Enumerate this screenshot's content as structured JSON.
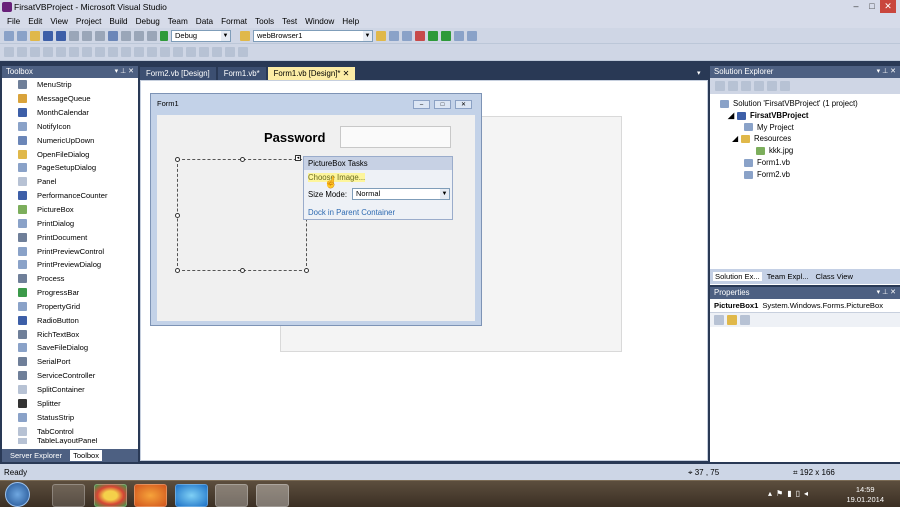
{
  "window": {
    "title": "FirsatVBProject - Microsoft Visual Studio"
  },
  "menu": [
    "File",
    "Edit",
    "View",
    "Project",
    "Build",
    "Debug",
    "Team",
    "Data",
    "Format",
    "Tools",
    "Test",
    "Window",
    "Help"
  ],
  "toolbar": {
    "config": "Debug",
    "target": "webBrowser1"
  },
  "toolbox": {
    "title": "Toolbox",
    "items": [
      "MenuStrip",
      "MessageQueue",
      "MonthCalendar",
      "NotifyIcon",
      "NumericUpDown",
      "OpenFileDialog",
      "PageSetupDialog",
      "Panel",
      "PerformanceCounter",
      "PictureBox",
      "PrintDialog",
      "PrintDocument",
      "PrintPreviewControl",
      "PrintPreviewDialog",
      "Process",
      "ProgressBar",
      "PropertyGrid",
      "RadioButton",
      "RichTextBox",
      "SaveFileDialog",
      "SerialPort",
      "ServiceController",
      "SplitContainer",
      "Splitter",
      "StatusStrip",
      "TabControl",
      "TableLayoutPanel"
    ],
    "bottom_tabs": [
      "Server Explorer",
      "Toolbox"
    ]
  },
  "doc_tabs": [
    "Form2.vb [Design]",
    "Form1.vb*",
    "Form1.vb [Design]*"
  ],
  "form": {
    "caption": "Form1",
    "password_label": "Password"
  },
  "tasks": {
    "title": "PictureBox Tasks",
    "choose": "Choose Image...",
    "size_mode_label": "Size Mode:",
    "size_mode_value": "Normal",
    "dock": "Dock in Parent Container"
  },
  "solution_explorer": {
    "title": "Solution Explorer",
    "solution": "Solution 'FirsatVBProject' (1 project)",
    "project": "FirsatVBProject",
    "items": [
      "My Project",
      "Resources",
      "kkk.jpg",
      "Form1.vb",
      "Form2.vb"
    ],
    "tabs": [
      "Solution Ex...",
      "Team Expl...",
      "Class View"
    ]
  },
  "properties": {
    "title": "Properties",
    "object": "PictureBox1",
    "type": "System.Windows.Forms.PictureBox"
  },
  "status": {
    "text": "Ready",
    "position": "37 , 75",
    "size": "192 x 166"
  },
  "clock": {
    "time": "14:59",
    "date": "19.01.2014"
  }
}
